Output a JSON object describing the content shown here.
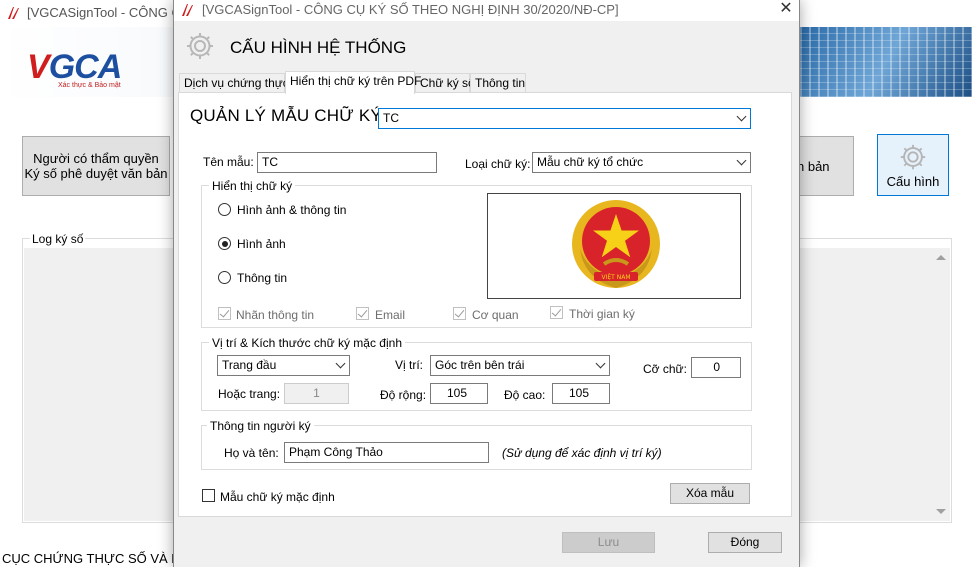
{
  "colors": {
    "accent": "#0078d7",
    "logo_red": "#d01e1e",
    "logo_blue": "#1d4fa0"
  },
  "main_window": {
    "title": "[VGCASignTool - CÔNG CỤ",
    "logo": {
      "text_v": "V",
      "text_rest": "GCA",
      "tagline": "Xác thực & Bảo mật"
    },
    "buttons": {
      "left_line1": "Người có thẩm quyền",
      "left_line2": "Ký số phê duyệt văn bản",
      "mid_label": "n bản",
      "config_label": "Cấu hình"
    },
    "log_label": "Log ký số",
    "footer": "CỤC CHỨNG THỰC SỐ VÀ BẢO M"
  },
  "dialog": {
    "title": "[VGCASignTool - CÔNG CỤ KÝ SỐ THEO NGHỊ ĐỊNH 30/2020/NĐ-CP]",
    "close_symbol": "✕",
    "header": "CẤU HÌNH HỆ THỐNG",
    "tabs": [
      {
        "label": "Dịch vụ chứng thực"
      },
      {
        "label": "Hiển thị chữ ký trên PDF"
      },
      {
        "label": "Chữ ký số"
      },
      {
        "label": "Thông tin"
      }
    ],
    "template_manager": {
      "label": "QUẢN LÝ MẪU CHỮ KÝ:",
      "selected": "TC"
    },
    "template_name": {
      "label": "Tên mẫu:",
      "value": "TC"
    },
    "signature_type": {
      "label": "Loại chữ ký:",
      "selected": "Mẫu chữ ký tổ chức"
    },
    "display_group": {
      "title": "Hiển thị chữ ký",
      "options": [
        "Hình ảnh & thông tin",
        "Hình ảnh",
        "Thông tin"
      ],
      "selected": "Hình ảnh",
      "checks": [
        "Nhãn thông tin",
        "Email",
        "Cơ quan",
        "Thời gian ký"
      ],
      "emblem_text": "VIỆT NAM"
    },
    "position_group": {
      "title": "Vị trí  & Kích thước chữ ký mặc định",
      "page_selected": "Trang đầu",
      "position_label": "Vị trí:",
      "position_selected": "Góc trên bên trái",
      "font_size_label": "Cỡ chữ:",
      "font_size": "0",
      "or_page_label": "Hoặc trang:",
      "or_page": "1",
      "width_label": "Độ rộng:",
      "width": "105",
      "height_label": "Độ cao:",
      "height": "105"
    },
    "signer_group": {
      "title": "Thông tin người ký",
      "name_label": "Họ và tên:",
      "name": "Phạm Công Thảo",
      "hint": "(Sử dụng để xác định vị trí ký)"
    },
    "default_checkbox": "Mẫu chữ ký mặc định",
    "delete_button": "Xóa mẫu",
    "save_button": "Lưu",
    "close_button": "Đóng"
  }
}
